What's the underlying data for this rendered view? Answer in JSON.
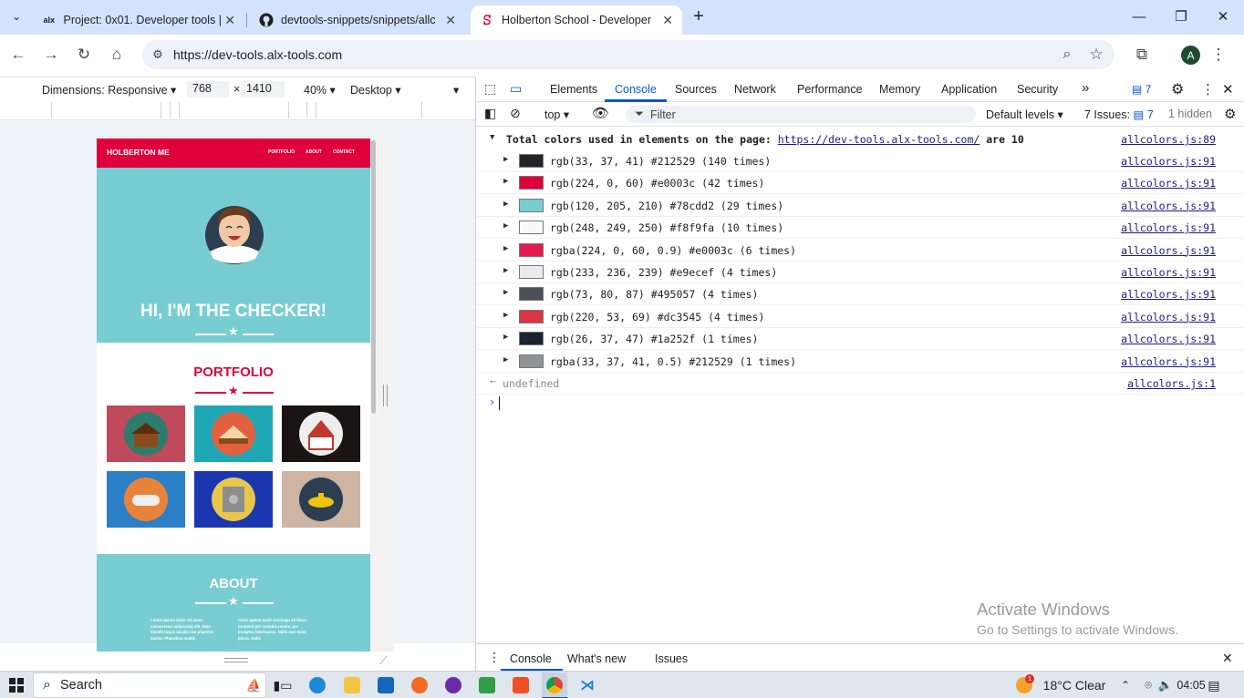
{
  "browser": {
    "tabs": [
      {
        "title": "Project: 0x01. Developer tools |",
        "icon": "alx-icon"
      },
      {
        "title": "devtools-snippets/snippets/allc",
        "icon": "github-icon"
      },
      {
        "title": "Holberton School - Developer t",
        "icon": "holberton-icon",
        "active": true
      }
    ],
    "new_tab": "+",
    "url": "https://dev-tools.alx-tools.com",
    "profile_initial": "A"
  },
  "device_toolbar": {
    "dimensions_label": "Dimensions: Responsive",
    "width": "768",
    "times": "×",
    "height": "1410",
    "zoom": "40%",
    "device_type": "Desktop"
  },
  "site": {
    "brand": "HOLBERTON ME",
    "nav": [
      "PORTFOLIO",
      "ABOUT",
      "CONTACT"
    ],
    "hero_title": "HI, I'M THE CHECKER!",
    "portfolio_title": "PORTFOLIO",
    "about_title": "ABOUT",
    "about_col1": "Lorem ipsum dolor sit amet, consectetur adipiscing elit. Nam blandit turpis iaculis nisi pharetra auctor. Phasellus mattis",
    "about_col2": "Class aptent taciti sociosqu ad litora torquent per conubia nostra, per inceptos himenaeos. Nulla non enim purus. Nulla",
    "tile_colors": [
      "#c0495c",
      "#1fa7b5",
      "#1a1414",
      "#2b7fc6",
      "#1a37b0",
      "#cdb4a3"
    ]
  },
  "devtools": {
    "tabs": [
      "Elements",
      "Console",
      "Sources",
      "Network",
      "Performance",
      "Memory",
      "Application",
      "Security"
    ],
    "active_tab": "Console",
    "more_tabs": "»",
    "issues_badge": "7",
    "context": "top",
    "filter_placeholder": "Filter",
    "levels": "Default levels",
    "issues_label": "7 Issues:",
    "issues_count": "7",
    "hidden": "1 hidden",
    "summary": {
      "prefix": "Total colors used in elements on the page:",
      "link": "https://dev-tools.alx-tools.com/",
      "suffix": "are 10",
      "source": "allcolors.js:89"
    },
    "entries": [
      {
        "color": "#212529",
        "text": "rgb(33, 37, 41) #212529 (140 times)",
        "source": "allcolors.js:91"
      },
      {
        "color": "#e0003c",
        "text": "rgb(224, 0, 60) #e0003c (42 times)",
        "source": "allcolors.js:91"
      },
      {
        "color": "#78cdd2",
        "text": "rgb(120, 205, 210) #78cdd2 (29 times)",
        "source": "allcolors.js:91"
      },
      {
        "color": "#f8f9fa",
        "text": "rgb(248, 249, 250) #f8f9fa (10 times)",
        "source": "allcolors.js:91"
      },
      {
        "color": "#e31a50",
        "text": "rgba(224, 0, 60, 0.9) #e0003c (6 times)",
        "source": "allcolors.js:91"
      },
      {
        "color": "#e9ecef",
        "text": "rgb(233, 236, 239) #e9ecef (4 times)",
        "source": "allcolors.js:91"
      },
      {
        "color": "#495057",
        "text": "rgb(73, 80, 87) #495057 (4 times)",
        "source": "allcolors.js:91"
      },
      {
        "color": "#dc3545",
        "text": "rgb(220, 53, 69) #dc3545 (4 times)",
        "source": "allcolors.js:91"
      },
      {
        "color": "#1a252f",
        "text": "rgb(26, 37, 47) #1a252f (1 times)",
        "source": "allcolors.js:91"
      },
      {
        "color": "#909294",
        "text": "rgba(33, 37, 41, 0.5) #212529 (1 times)",
        "source": "allcolors.js:91"
      }
    ],
    "result": "undefined",
    "result_source": "allcolors.js:1",
    "drawer_tabs": [
      "Console",
      "What's new",
      "Issues"
    ]
  },
  "watermark": {
    "line1": "Activate Windows",
    "line2": "Go to Settings to activate Windows."
  },
  "taskbar": {
    "search": "Search",
    "weather": "18°C Clear",
    "weather_badge": "1",
    "time": "04:05"
  }
}
